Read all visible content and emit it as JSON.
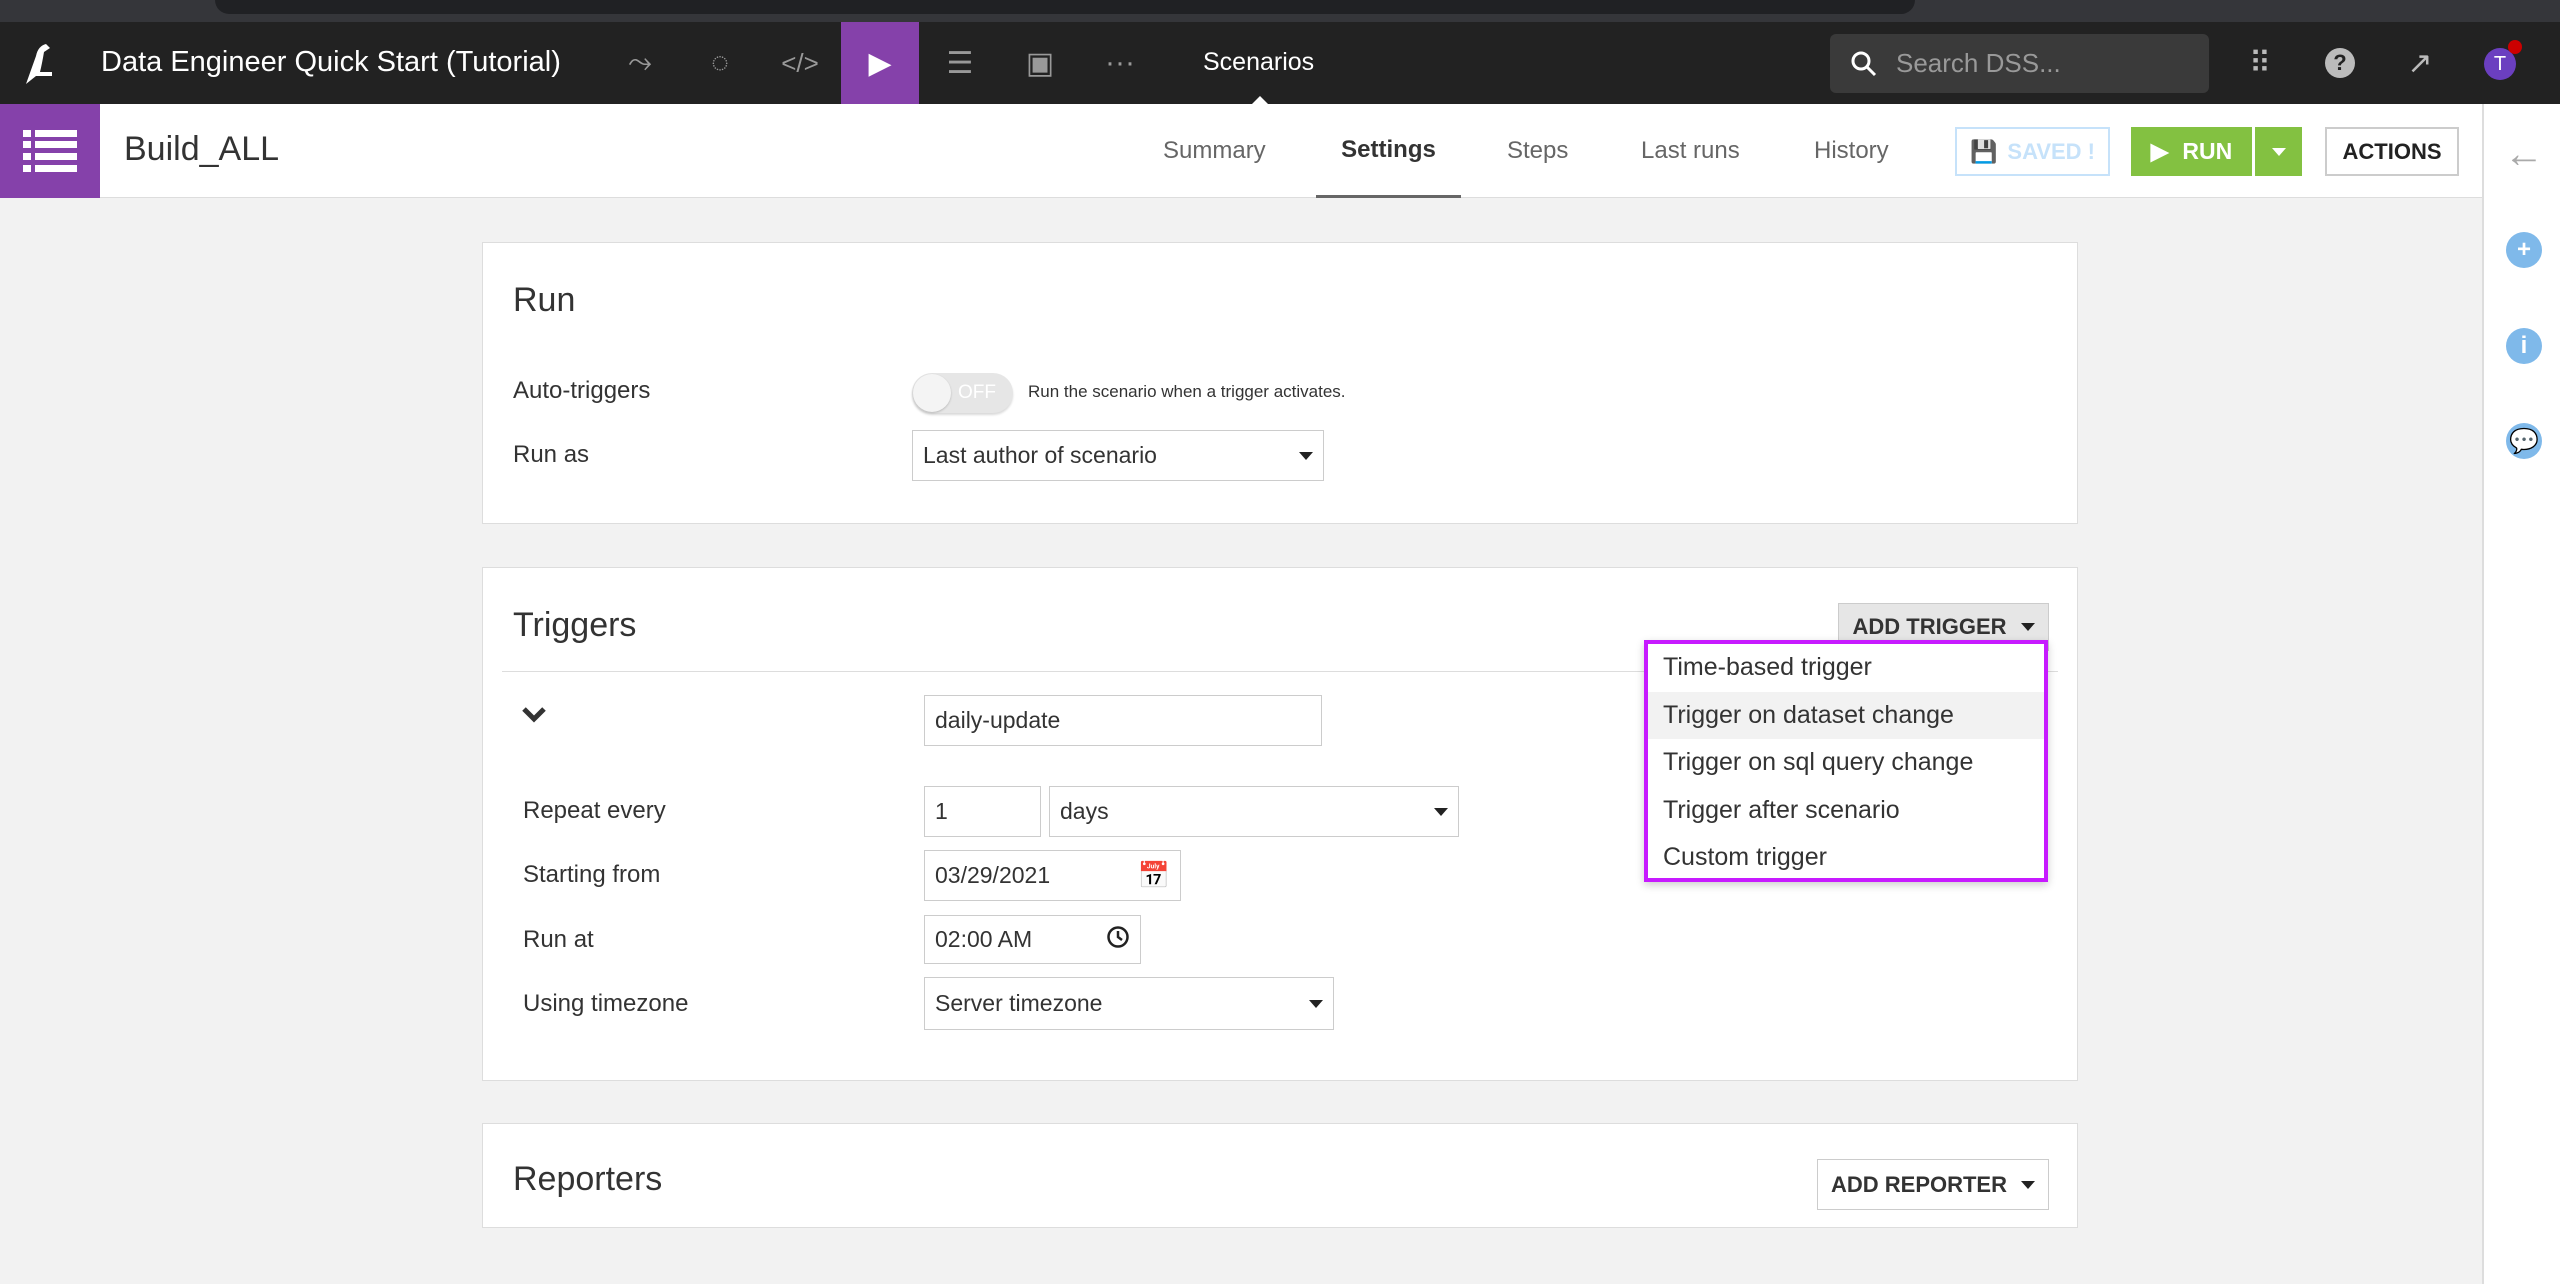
{
  "topnav": {
    "project_title": "Data Engineer Quick Start (Tutorial)",
    "current_section": "Scenarios",
    "search_placeholder": "Search DSS...",
    "avatar_letter": "T",
    "icons": [
      "flow-icon",
      "lab-icon",
      "code-icon",
      "scenarios-icon",
      "datasets-icon",
      "dashboard-icon",
      "more-icon"
    ]
  },
  "header": {
    "title": "Build_ALL",
    "tabs": [
      {
        "label": "Summary"
      },
      {
        "label": "Settings",
        "active": true
      },
      {
        "label": "Steps"
      },
      {
        "label": "Last runs"
      },
      {
        "label": "History"
      }
    ],
    "saved_label": "SAVED !",
    "run_label": "RUN",
    "actions_label": "ACTIONS"
  },
  "run_section": {
    "title": "Run",
    "auto_triggers_label": "Auto-triggers",
    "toggle_state": "OFF",
    "toggle_help": "Run the scenario when a trigger activates.",
    "run_as_label": "Run as",
    "run_as_value": "Last author of scenario"
  },
  "triggers_section": {
    "title": "Triggers",
    "add_trigger_label": "ADD TRIGGER",
    "trigger": {
      "name": "daily-update",
      "repeat_every_label": "Repeat every",
      "repeat_value": "1",
      "repeat_unit": "days",
      "starting_from_label": "Starting from",
      "starting_from_value": "03/29/2021",
      "run_at_label": "Run at",
      "run_at_value": "02:00 AM",
      "timezone_label": "Using timezone",
      "timezone_value": "Server timezone"
    },
    "menu": [
      {
        "label": "Time-based trigger"
      },
      {
        "label": "Trigger on dataset change",
        "hovered": true
      },
      {
        "label": "Trigger on sql query change"
      },
      {
        "label": "Trigger after scenario"
      },
      {
        "label": "Custom trigger"
      }
    ],
    "menu_highlight_color": "#c71aff"
  },
  "reporters_section": {
    "title": "Reporters",
    "add_reporter_label": "ADD REPORTER"
  },
  "colors": {
    "brand_purple": "#8541aa",
    "run_green": "#83c141",
    "saved_blue": "#c6e2fa"
  }
}
